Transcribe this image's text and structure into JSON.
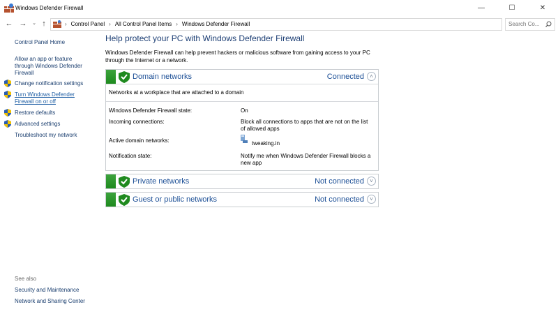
{
  "window": {
    "title": "Windows Defender Firewall",
    "minimize_icon": "minimize-icon",
    "maximize_icon": "maximize-icon",
    "close_icon": "close-icon"
  },
  "addressbar": {
    "crumbs": [
      "Control Panel",
      "All Control Panel Items",
      "Windows Defender Firewall"
    ],
    "search_placeholder": "Search Co..."
  },
  "sidebar": {
    "home": "Control Panel Home",
    "links": [
      {
        "label": "Allow an app or feature through Windows Defender Firewall",
        "icon": "none"
      },
      {
        "label": "Change notification settings",
        "icon": "shield-icon"
      },
      {
        "label": "Turn Windows Defender Firewall on or off",
        "icon": "shield-icon"
      },
      {
        "label": "Restore defaults",
        "icon": "shield-icon"
      },
      {
        "label": "Advanced settings",
        "icon": "shield-icon"
      },
      {
        "label": "Troubleshoot my network",
        "icon": "none"
      }
    ],
    "see_also_title": "See also",
    "see_also": [
      "Security and Maintenance",
      "Network and Sharing Center"
    ]
  },
  "main": {
    "heading": "Help protect your PC with Windows Defender Firewall",
    "description": "Windows Defender Firewall can help prevent hackers or malicious software from gaining access to your PC through the Internet or a network.",
    "domain": {
      "title": "Domain networks",
      "status": "Connected",
      "subtitle": "Networks at a workplace that are attached to a domain",
      "rows": [
        {
          "label": "Windows Defender Firewall state:",
          "value": "On"
        },
        {
          "label": "Incoming connections:",
          "value": "Block all connections to apps that are not on the list of allowed apps"
        },
        {
          "label": "Active domain networks:",
          "value": "tweaking.in"
        },
        {
          "label": "Notification state:",
          "value": "Notify me when Windows Defender Firewall blocks a new app"
        }
      ]
    },
    "private": {
      "title": "Private networks",
      "status": "Not connected"
    },
    "public": {
      "title": "Guest or public networks",
      "status": "Not connected"
    }
  },
  "colors": {
    "accent_green": "#2a9a2a",
    "link_blue": "#1c4f96"
  }
}
